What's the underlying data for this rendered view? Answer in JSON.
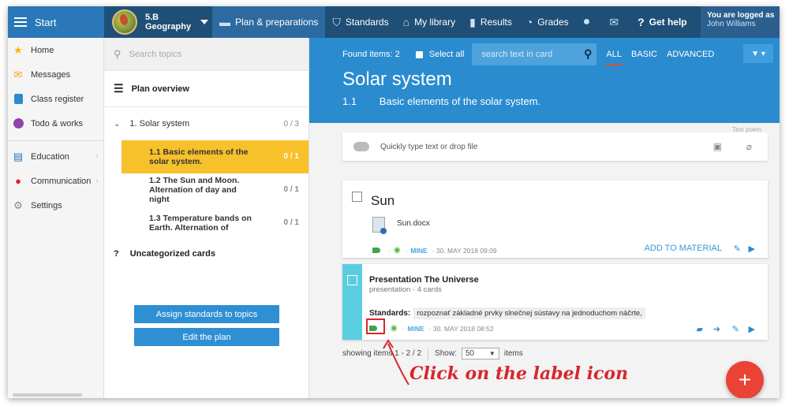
{
  "topbar": {
    "start_label": "Start",
    "class_code": "5.B",
    "class_subject": "Geography",
    "nav": [
      {
        "label": "Plan & preparations",
        "icon": "briefcase-icon"
      },
      {
        "label": "Standards",
        "icon": "shield-icon"
      },
      {
        "label": "My library",
        "icon": "library-icon"
      },
      {
        "label": "Results",
        "icon": "bar-chart-icon"
      },
      {
        "label": "Grades",
        "icon": "grades-icon"
      }
    ],
    "help_label": "Get help",
    "logged_as": "You are logged as",
    "user_name": "John Williams"
  },
  "leftnav": {
    "items": [
      {
        "label": "Home",
        "icon": "star-icon"
      },
      {
        "label": "Messages",
        "icon": "envelope-icon"
      },
      {
        "label": "Class register",
        "icon": "register-icon"
      },
      {
        "label": "Todo & works",
        "icon": "clock-icon"
      }
    ],
    "items2": [
      {
        "label": "Education",
        "icon": "education-icon"
      },
      {
        "label": "Communication",
        "icon": "communication-icon"
      },
      {
        "label": "Settings",
        "icon": "gear-icon"
      }
    ]
  },
  "topics": {
    "search_placeholder": "Search topics",
    "plan_overview": "Plan overview",
    "chapter": {
      "label": "1. Solar system",
      "count": "0 / 3"
    },
    "subtopics": [
      {
        "label": "1.1 Basic elements of the solar system.",
        "count": "0 / 1"
      },
      {
        "label": "1.2 The Sun and Moon. Alternation of day and night",
        "count": "0 / 1"
      },
      {
        "label": "1.3 Temperature bands on Earth. Alternation of",
        "count": "0 / 1"
      }
    ],
    "uncategorized": "Uncategorized cards",
    "assign_button": "Assign standards to topics",
    "edit_button": "Edit the plan"
  },
  "main": {
    "found": "Found items: 2",
    "select_all": "Select all",
    "search_placeholder": "search text in card",
    "tabs": [
      "ALL",
      "BASIC",
      "ADVANCED"
    ],
    "title": "Solar system",
    "sub_num": "1.1",
    "sub_text": "Basic elements of the solar system.",
    "quick_placeholder": "Quickly type text or drop file",
    "quick_hint": "Text poem",
    "cards": [
      {
        "title": "Sun",
        "file": "Sun.docx",
        "owner": "MINE",
        "date": "30. MAY 2018 09:09",
        "action": "ADD TO MATERIAL"
      },
      {
        "title": "Presentation The Universe",
        "subtitle": "presentation · 4 cards",
        "standards_label": "Standards:",
        "standard": "rozpoznať základné prvky slnečnej sústavy na jednoduchom náčrte,",
        "owner": "MINE",
        "date": "30. MAY 2018 08:52"
      }
    ],
    "showing": "showing items 1 - 2 / 2",
    "show_label": "Show:",
    "show_value": "50",
    "items_label": "items"
  },
  "annotation": "Click on the label icon",
  "colors": {
    "accent": "#2a8bcf",
    "active_topic": "#f7c12b",
    "annotation": "#d9262e",
    "fab": "#ea4335"
  }
}
